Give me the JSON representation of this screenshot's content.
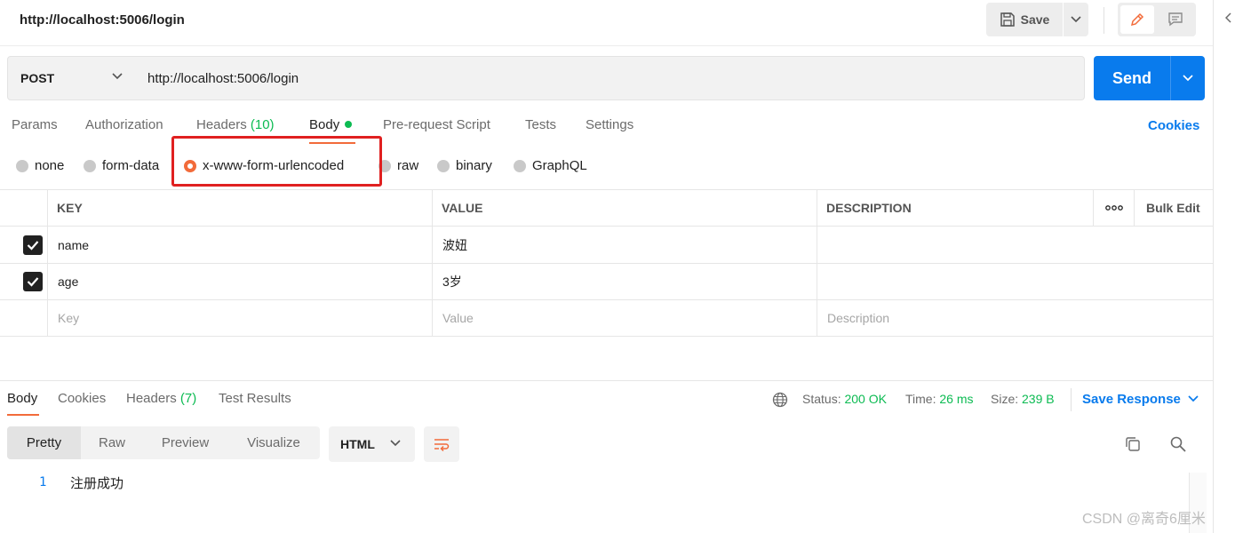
{
  "request": {
    "title": "http://localhost:5006/login",
    "method": "POST",
    "url": "http://localhost:5006/login"
  },
  "toolbar": {
    "save_label": "Save",
    "send_label": "Send",
    "cookies_label": "Cookies"
  },
  "request_tabs": {
    "params": "Params",
    "authorization": "Authorization",
    "headers": "Headers",
    "headers_count": "(10)",
    "body": "Body",
    "pre_request": "Pre-request Script",
    "tests": "Tests",
    "settings": "Settings"
  },
  "body_types": {
    "none": "none",
    "form_data": "form-data",
    "urlencoded": "x-www-form-urlencoded",
    "raw": "raw",
    "binary": "binary",
    "graphql": "GraphQL",
    "selected": "x-www-form-urlencoded"
  },
  "params_table": {
    "headers": {
      "key": "KEY",
      "value": "VALUE",
      "description": "DESCRIPTION",
      "more": "ooo",
      "bulk_edit": "Bulk Edit"
    },
    "rows": [
      {
        "checked": true,
        "key": "name",
        "value": "波妞",
        "description": ""
      },
      {
        "checked": true,
        "key": "age",
        "value": "3岁",
        "description": ""
      }
    ],
    "placeholders": {
      "key": "Key",
      "value": "Value",
      "description": "Description"
    }
  },
  "response": {
    "tabs": {
      "body": "Body",
      "cookies": "Cookies",
      "headers": "Headers",
      "headers_count": "(7)",
      "test_results": "Test Results"
    },
    "status_label": "Status:",
    "status_value": "200 OK",
    "time_label": "Time:",
    "time_value": "26 ms",
    "size_label": "Size:",
    "size_value": "239 B",
    "save_response": "Save Response",
    "views": {
      "pretty": "Pretty",
      "raw": "Raw",
      "preview": "Preview",
      "visualize": "Visualize"
    },
    "format": "HTML",
    "lines": [
      {
        "no": "1",
        "text": "注册成功"
      }
    ]
  },
  "watermark": "CSDN @离奇6厘米",
  "colors": {
    "accent": "#f26b3a",
    "primary": "#097bed",
    "success": "#0cbb52",
    "highlight": "#e02020"
  }
}
